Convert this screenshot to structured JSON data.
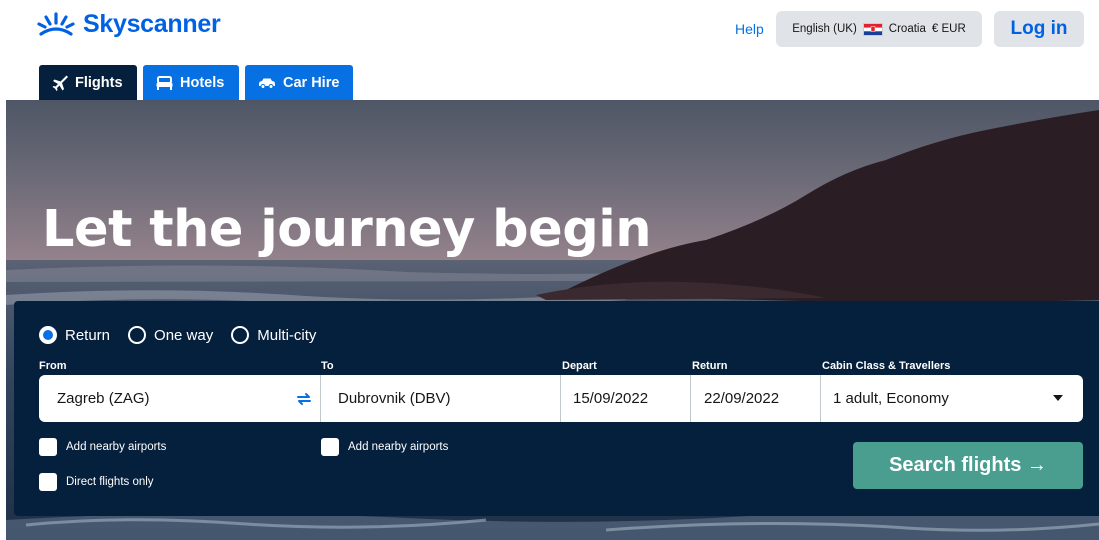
{
  "header": {
    "brand": "Skyscanner",
    "help_label": "Help",
    "locale": {
      "language": "English (UK)",
      "country": "Croatia",
      "currency": "€ EUR"
    },
    "login_label": "Log in"
  },
  "tabs": [
    {
      "label": "Flights",
      "icon": "plane-icon",
      "active": true
    },
    {
      "label": "Hotels",
      "icon": "bed-icon",
      "active": false
    },
    {
      "label": "Car Hire",
      "icon": "car-icon",
      "active": false
    }
  ],
  "hero": {
    "title": "Let the journey begin"
  },
  "search": {
    "trip_types": [
      {
        "label": "Return",
        "selected": true
      },
      {
        "label": "One way",
        "selected": false
      },
      {
        "label": "Multi-city",
        "selected": false
      }
    ],
    "labels": {
      "from": "From",
      "to": "To",
      "depart": "Depart",
      "return": "Return",
      "cabin": "Cabin Class & Travellers"
    },
    "values": {
      "from": "Zagreb (ZAG)",
      "to": "Dubrovnik (DBV)",
      "depart": "15/09/2022",
      "return": "22/09/2022",
      "cabin": "1 adult, Economy"
    },
    "options": {
      "nearby_from": "Add nearby airports",
      "nearby_to": "Add nearby airports",
      "direct": "Direct flights only"
    },
    "button_label": "Search flights →"
  },
  "colors": {
    "brand_blue": "#0062e3",
    "tab_blue": "#0770e3",
    "panel_navy": "#05203c",
    "search_green": "#4a9e90"
  }
}
